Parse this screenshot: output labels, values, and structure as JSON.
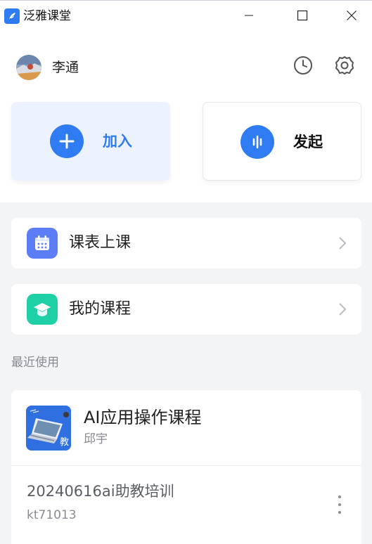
{
  "app": {
    "title": "泛雅课堂",
    "accent": "#2f7bf2"
  },
  "window_controls": [
    "minimize-icon",
    "maximize-icon",
    "close-icon"
  ],
  "user": {
    "name": "李通",
    "icons": [
      "history-clock-icon",
      "settings-gear-icon"
    ]
  },
  "actions": {
    "join": {
      "label": "加入",
      "icon": "plus-icon",
      "color": "#2f7bf2"
    },
    "start": {
      "label": "发起",
      "icon": "audio-bars-icon",
      "color": "#111111"
    }
  },
  "menu": [
    {
      "label": "课表上课",
      "icon": "calendar-icon",
      "icon_color": "#5b7df5"
    },
    {
      "label": "我的课程",
      "icon": "graduation-cap-icon",
      "icon_color": "#1fcfa6"
    }
  ],
  "recent": {
    "title": "最近使用",
    "course": {
      "name": "AI应用操作课程",
      "teacher": "邱宇",
      "thumb_badge": "教"
    },
    "class": {
      "name": "20240616ai助教培训",
      "code": "kt71013"
    }
  }
}
